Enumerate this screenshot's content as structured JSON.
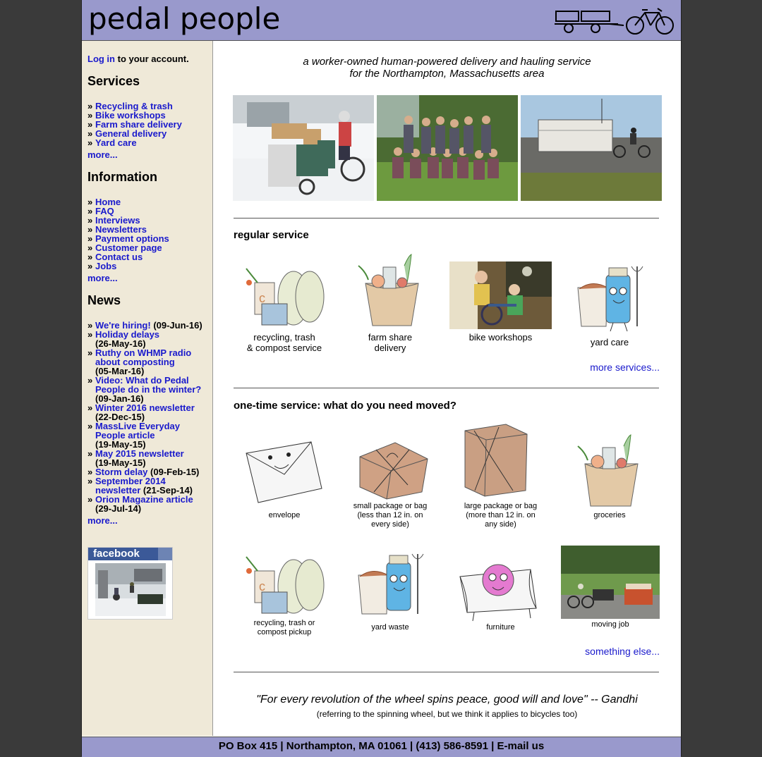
{
  "header": {
    "title": "pedal people"
  },
  "sidebar": {
    "login_link": "Log in",
    "login_rest": " to your account.",
    "services": {
      "heading": "Services",
      "items": [
        "Recycling & trash",
        "Bike workshops",
        "Farm share delivery",
        "General delivery",
        "Yard care"
      ],
      "more": "more..."
    },
    "information": {
      "heading": "Information",
      "items": [
        "Home",
        "FAQ",
        "Interviews",
        "Newsletters",
        "Payment options",
        "Customer page",
        "Contact us",
        "Jobs"
      ],
      "more": "more..."
    },
    "news": {
      "heading": "News",
      "items": [
        {
          "title": "We're hiring!",
          "date": " (09-Jun-16)"
        },
        {
          "title": "Holiday delays",
          "date": "(26-May-16)"
        },
        {
          "title": "Ruthy on WHMP radio about composting",
          "date": "(05-Mar-16)"
        },
        {
          "title": "Video: What do Pedal People do in the winter?",
          "date": "(09-Jan-16)"
        },
        {
          "title": "Winter 2016 newsletter",
          "date": "(22-Dec-15)"
        },
        {
          "title": "MassLive Everyday People article",
          "date": "(19-May-15)"
        },
        {
          "title": "May 2015 newsletter",
          "date": "(19-May-15)"
        },
        {
          "title": "Storm delay",
          "date": " (09-Feb-15)"
        },
        {
          "title": "September 2014 newsletter",
          "date": " (21-Sep-14)"
        },
        {
          "title": "Orion Magazine article",
          "date": "(29-Jul-14)"
        }
      ],
      "more": "more..."
    },
    "facebook": "facebook"
  },
  "main": {
    "tagline_1": "a worker-owned human-powered delivery and hauling service",
    "tagline_2": "for the Northampton, Massachusetts area",
    "regular": {
      "title": "regular service",
      "items": [
        "recycling, trash\n& compost service",
        "farm share\ndelivery",
        "bike workshops",
        "yard care"
      ],
      "more": "more services..."
    },
    "onetime": {
      "title": "one-time service: what do you need moved?",
      "items": [
        "envelope",
        "small package or bag\n(less than 12 in. on\nevery side)",
        "large package or bag\n(more than 12 in. on\nany side)",
        "groceries",
        "recycling, trash or\ncompost pickup",
        "yard waste",
        "furniture",
        "moving job"
      ],
      "more": "something else..."
    },
    "quote": "\"For every revolution of the wheel spins peace, good will and love\" -- Gandhi",
    "quote_sub": "(referring to the spinning wheel, but we think it applies to bicycles too)"
  },
  "footer": {
    "text": "PO Box 415 | Northampton, MA 01061 | (413) 586-8591 | E-mail us"
  }
}
